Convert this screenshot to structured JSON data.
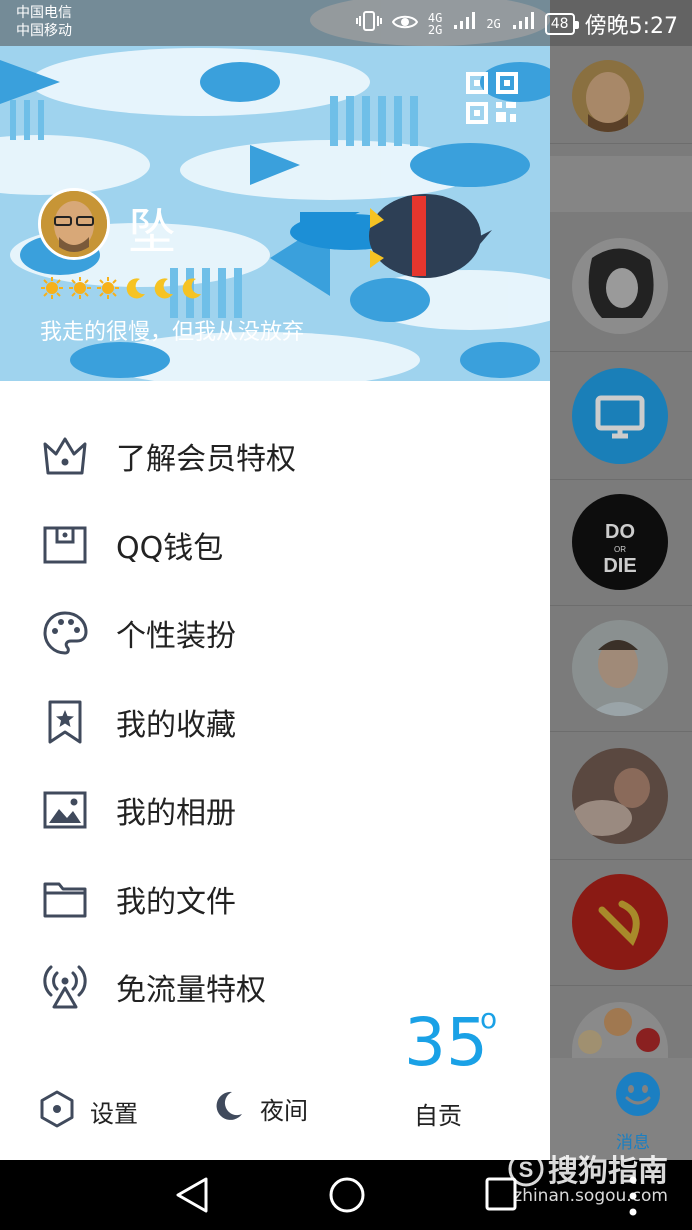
{
  "status_bar": {
    "carrier_1": "中国电信",
    "carrier_2": "中国移动",
    "sig_1": "4G\n2G",
    "sig_2": "2G",
    "battery": "48",
    "time": "傍晚5:27"
  },
  "profile": {
    "nickname": "坠",
    "level_icons": [
      "sun-icon",
      "sun-icon",
      "sun-icon",
      "moon-icon",
      "moon-icon",
      "moon-icon"
    ],
    "signature": "我走的很慢，但我从没放弃"
  },
  "menu": [
    {
      "label": "了解会员特权",
      "icon": "crown-icon"
    },
    {
      "label": "QQ钱包",
      "icon": "wallet-icon"
    },
    {
      "label": "个性装扮",
      "icon": "palette-icon"
    },
    {
      "label": "我的收藏",
      "icon": "bookmark-icon"
    },
    {
      "label": "我的相册",
      "icon": "photo-icon"
    },
    {
      "label": "我的文件",
      "icon": "folder-icon"
    },
    {
      "label": "免流量特权",
      "icon": "signal-tower-icon"
    }
  ],
  "weather": {
    "temperature": "35",
    "degree": "o",
    "city": "自贡"
  },
  "bottom_bar": {
    "settings_label": "设置",
    "night_label": "夜间"
  },
  "right_tab": {
    "messages_label": "消息"
  },
  "watermark": {
    "brand": "搜狗指南",
    "url": "zhinan.sogou.com"
  },
  "colors": {
    "accent": "#1aa1e6",
    "banner_bg": "#9fd3ee",
    "text": "#222222"
  }
}
